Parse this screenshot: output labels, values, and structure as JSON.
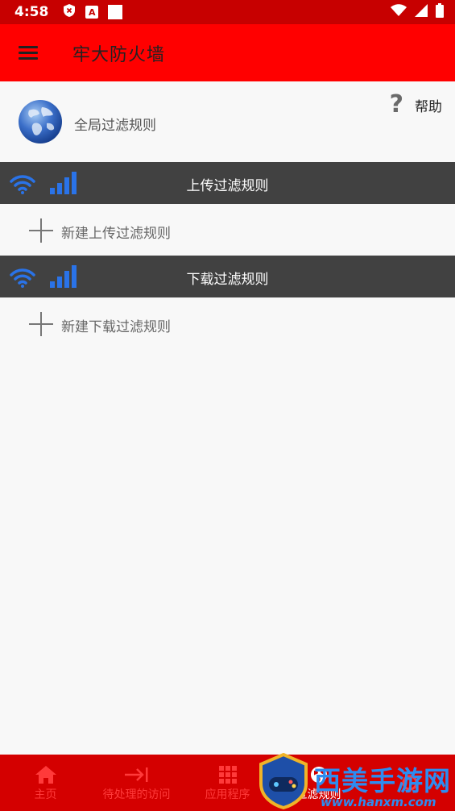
{
  "status_bar": {
    "time": "4:58",
    "letter_icon": "A"
  },
  "app_bar": {
    "title": "牢大防火墙"
  },
  "global_filter": {
    "label": "全局过滤规则",
    "help_label": "帮助"
  },
  "upload": {
    "header": "上传过滤规则",
    "add_label": "新建上传过滤规则"
  },
  "download": {
    "header": "下载过滤规则",
    "add_label": "新建下载过滤规则"
  },
  "bottom_nav": {
    "items": [
      {
        "label": "主页",
        "icon": "home-icon"
      },
      {
        "label": "待处理的访问",
        "icon": "arrow-to-bar-icon"
      },
      {
        "label": "应用程序",
        "icon": "grid-icon"
      },
      {
        "label": "过滤规则",
        "icon": "globe-icon"
      },
      {
        "label": "",
        "icon": "settings-icon"
      }
    ],
    "active_index": 3
  },
  "watermark": {
    "text": "西美手游网",
    "url": "www.hanxm.com"
  },
  "colors": {
    "status_bar": "#c70000",
    "app_bar": "#ff0000",
    "section_header": "#414141",
    "bottom_nav": "#d40000",
    "accent_blue": "#2a73e8"
  }
}
